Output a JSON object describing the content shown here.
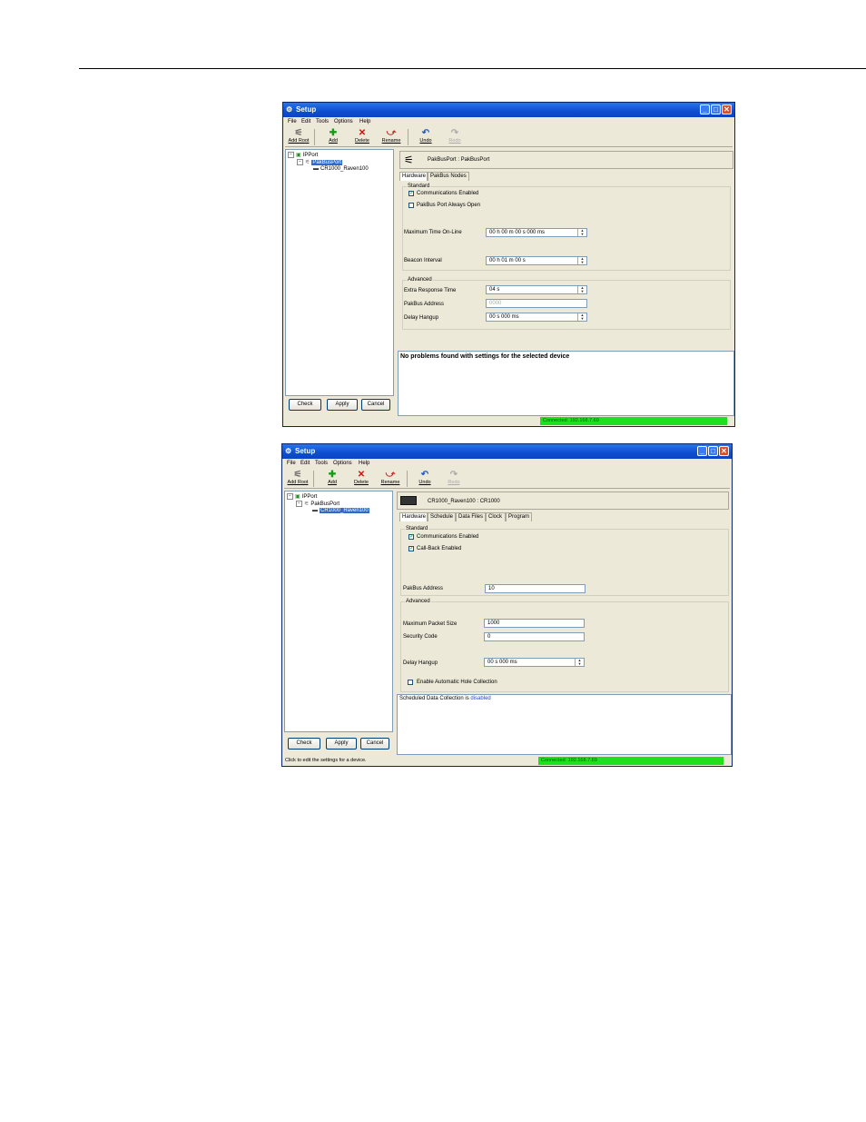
{
  "window_title": "Setup",
  "menu": [
    "File",
    "Edit",
    "Tools",
    "Options",
    "Help"
  ],
  "toolbar": {
    "add_root": "Add Root",
    "add": "Add",
    "delete": "Delete",
    "rename": "Rename",
    "undo": "Undo",
    "redo": "Redo"
  },
  "buttons": {
    "check": "Check",
    "apply": "Apply",
    "cancel": "Cancel"
  },
  "tree": {
    "root": "IPPort",
    "port": "PakBusPort",
    "device": "CR1000_Raven100"
  },
  "win1": {
    "header": "PakBusPort : PakBusPort",
    "tabs": [
      "Hardware",
      "PakBus Nodes"
    ],
    "standard_label": "Standard",
    "comm_enabled": "Communications Enabled",
    "port_always_open": "PakBus Port Always Open",
    "max_time_label": "Maximum Time On-Line",
    "max_time_value": "00 h 00 m 00 s 000 ms",
    "beacon_label": "Beacon Interval",
    "beacon_value": "00 h 01 m 00 s",
    "advanced_label": "Advanced",
    "extra_resp_label": "Extra Response Time",
    "extra_resp_value": "04 s",
    "pakbus_addr_label": "PakBus Address",
    "pakbus_addr_value": "0000",
    "delay_label": "Delay Hangup",
    "delay_value": "00 s 000 ms",
    "message": "No problems found with settings for the selected device",
    "status": "Connected: 192.168.7.69"
  },
  "win2": {
    "header": "CR1000_Raven100 : CR1000",
    "tabs": [
      "Hardware",
      "Schedule",
      "Data Files",
      "Clock",
      "Program"
    ],
    "standard_label": "Standard",
    "comm_enabled": "Communications Enabled",
    "callback_enabled": "Call-Back Enabled",
    "pakbus_addr_label": "PakBus Address",
    "pakbus_addr_value": "10",
    "advanced_label": "Advanced",
    "max_packet_label": "Maximum Packet Size",
    "max_packet_value": "1000",
    "security_label": "Security Code",
    "security_value": "0",
    "delay_label": "Delay Hangup",
    "delay_value": "00 s 000 ms",
    "hole_collection": "Enable Automatic Hole Collection",
    "sched_text": "Scheduled Data Collection is",
    "sched_state": "disabled",
    "status_left": "Click to edit the settings for a device.",
    "status": "Connected: 192.168.7.69"
  }
}
